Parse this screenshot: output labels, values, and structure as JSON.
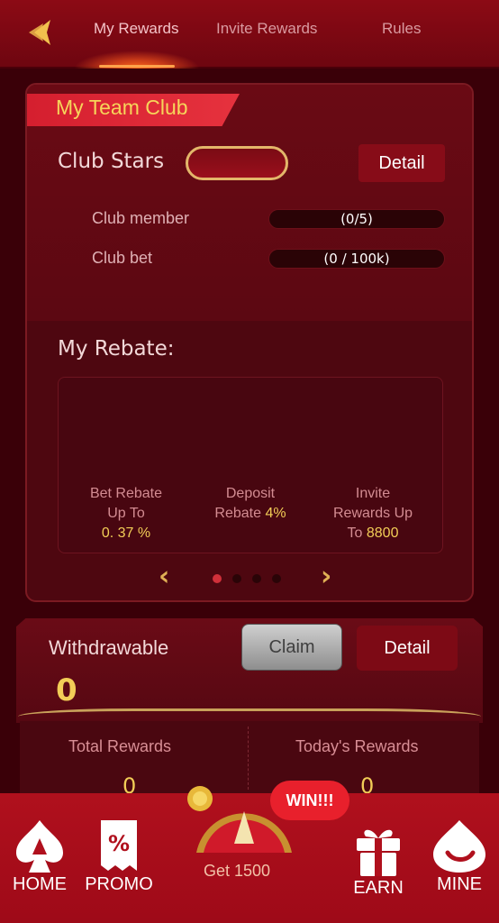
{
  "tabs": [
    {
      "label": "My Rewards"
    },
    {
      "label": "Invite Rewards"
    },
    {
      "label": "Rules"
    }
  ],
  "club": {
    "title": "My Team Club",
    "stars_label": "Club Stars",
    "detail_label": "Detail",
    "stats": [
      {
        "label": "Club member",
        "value": "(0/5)"
      },
      {
        "label": "Club bet",
        "value": "(0 / 100k)"
      }
    ]
  },
  "rebate": {
    "title": "My Rebate:",
    "items": [
      {
        "line1": "Bet Rebate",
        "line2": "Up To",
        "value": "0. 37 %"
      },
      {
        "line1": "Deposit",
        "line2": "Rebate",
        "value": "4%"
      },
      {
        "line1": "Invite",
        "line2": "Rewards Up",
        "line3": "To",
        "value": "8800"
      }
    ],
    "page_count": 4,
    "active_page": 1
  },
  "withdraw": {
    "label": "Withdrawable",
    "value": "0",
    "claim_label": "Claim",
    "detail_label": "Detail"
  },
  "totals": [
    {
      "label": "Total Rewards",
      "value": "0"
    },
    {
      "label": "Today's Rewards",
      "value": "0"
    }
  ],
  "wheel": {
    "get_label": "Get 1500",
    "win_badge": "WIN!!!"
  },
  "bottom_nav": [
    {
      "label": "HOME",
      "icon": "spade-icon"
    },
    {
      "label": "PROMO",
      "icon": "percent-ticket-icon"
    },
    {
      "label": "EARN",
      "icon": "gift-icon"
    },
    {
      "label": "MINE",
      "icon": "smile-drop-icon"
    }
  ],
  "colors": {
    "accent_gold": "#f2cd57",
    "primary_red": "#b0101d",
    "background": "#3a0008"
  }
}
